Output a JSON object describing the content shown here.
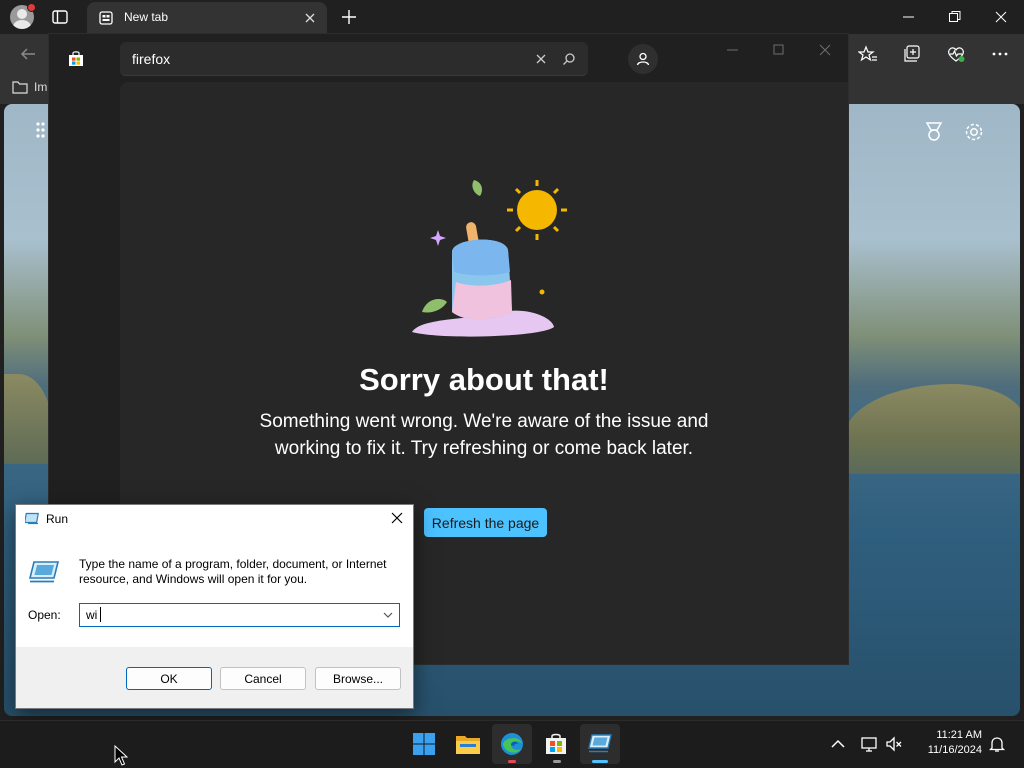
{
  "browser": {
    "tab_title": "New tab",
    "favorites_item": "Im"
  },
  "store": {
    "search_value": "firefox",
    "error_title": "Sorry about that!",
    "error_message": "Something went wrong. We're aware of the issue and working to fix it. Try refreshing or come back later.",
    "refresh_label": "Refresh the page"
  },
  "run_dialog": {
    "title": "Run",
    "description": "Type the name of a program, folder, document, or Internet resource, and Windows will open it for you.",
    "open_label": "Open:",
    "open_value": "wi",
    "ok_label": "OK",
    "cancel_label": "Cancel",
    "browse_label": "Browse..."
  },
  "taskbar": {
    "apps": [
      "start-icon",
      "file-explorer-icon",
      "edge-icon",
      "store-icon",
      "run-icon"
    ],
    "time": "11:21 AM",
    "date": "11/16/2024"
  },
  "colors": {
    "accent": "#4cc2ff",
    "dialog_accent": "#0067c0",
    "chrome_bg": "#202020",
    "toolbar_bg": "#333333"
  }
}
